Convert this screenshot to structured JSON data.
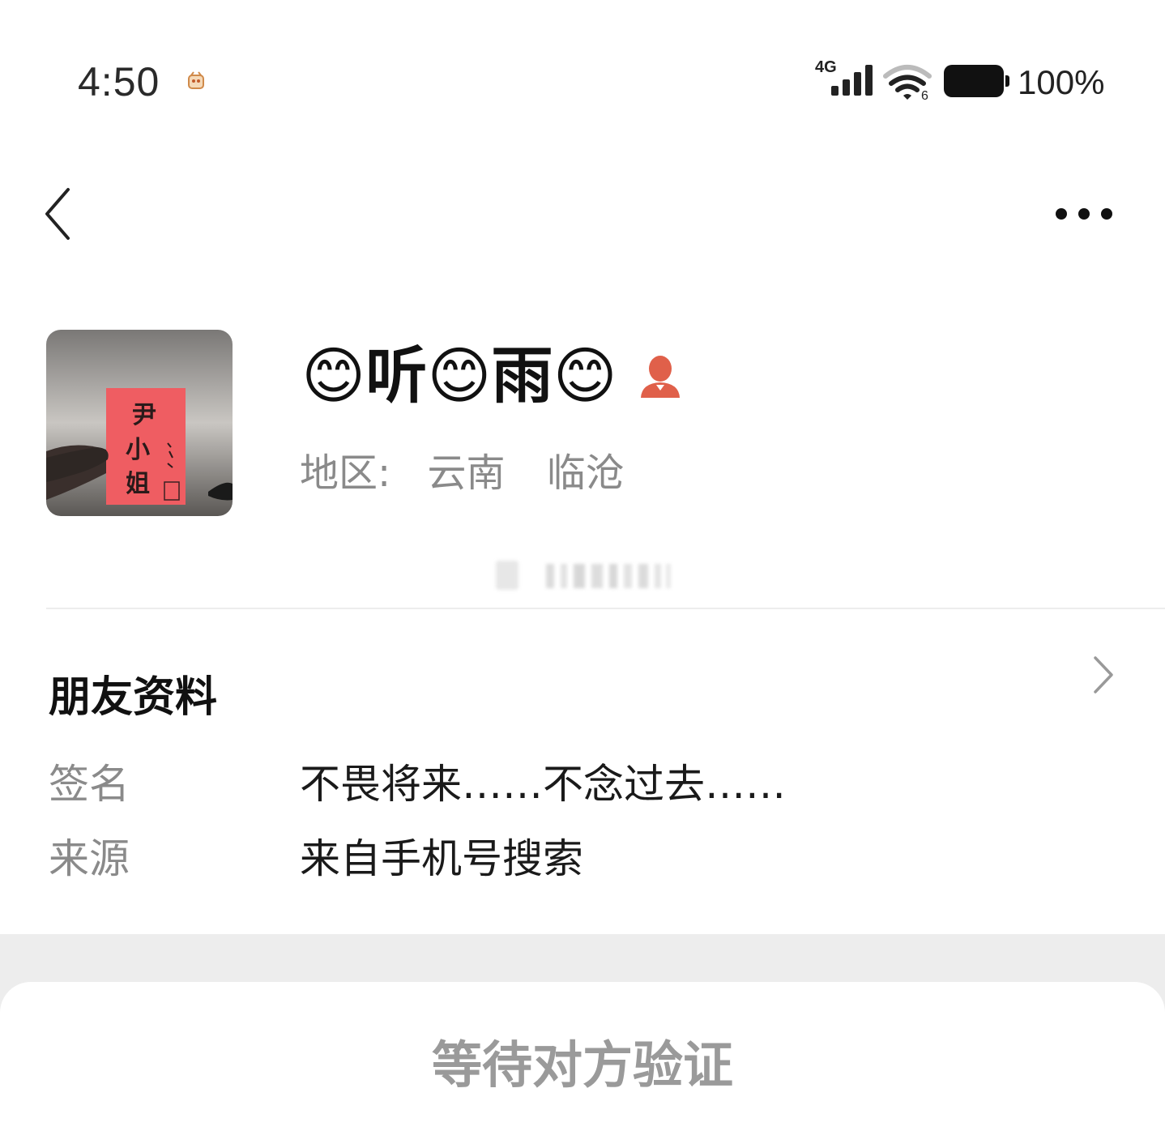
{
  "status_bar": {
    "time": "4:50",
    "network_type": "4G",
    "wifi_badge": "6",
    "battery_text": "100%",
    "icons": [
      "notification-icon",
      "signal-icon",
      "wifi-icon",
      "battery-icon"
    ]
  },
  "nav": {
    "back_icon": "chevron-left-icon",
    "more_icon": "more-dots-icon"
  },
  "profile": {
    "nickname": "😊听😊雨😊",
    "gender_icon": "female-gender-icon",
    "region_label": "地区:",
    "region_province": "云南",
    "region_city": "临沧",
    "avatar_text": [
      "尹",
      "小",
      "姐"
    ]
  },
  "friend_info": {
    "title": "朋友资料",
    "rows": [
      {
        "label": "签名",
        "value": "不畏将来……不念过去……"
      },
      {
        "label": "来源",
        "value": "来自手机号搜索"
      }
    ]
  },
  "action": {
    "label": "等待对方验证"
  },
  "colors": {
    "text_primary": "#111111",
    "text_secondary": "#8a8a8a",
    "divider": "#ededed",
    "accent_gender": "#e0604a",
    "disabled_button": "#9a9a9a"
  }
}
